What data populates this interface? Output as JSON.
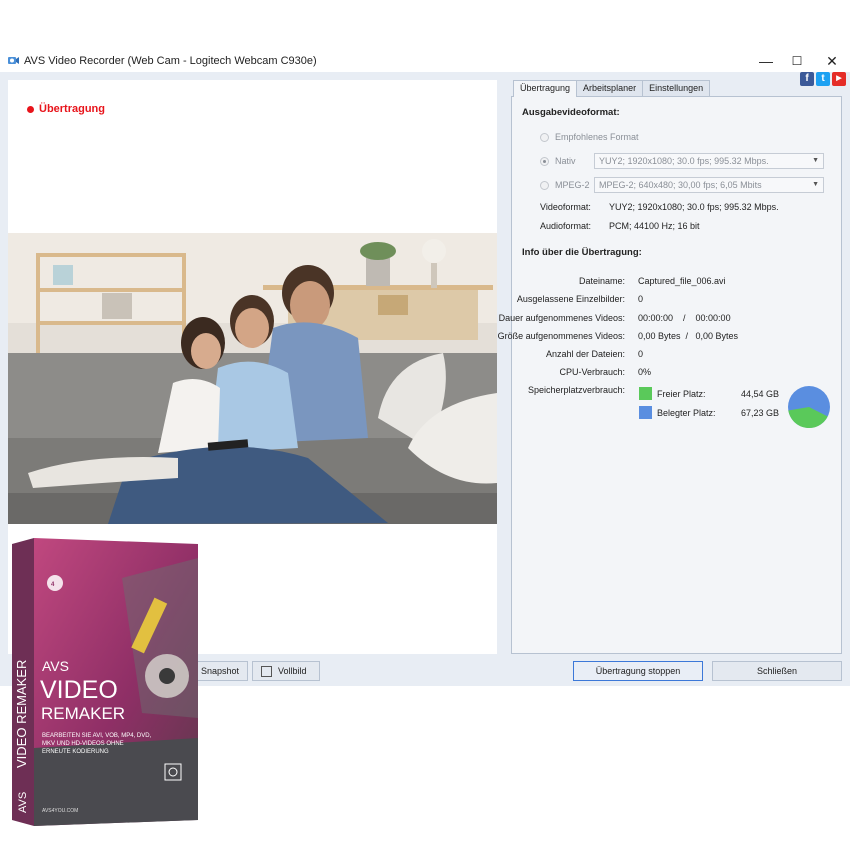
{
  "window": {
    "title": "AVS Video Recorder (Web Cam - Logitech Webcam C930e)",
    "minimize": "—",
    "maximize": "☐",
    "close": "✕"
  },
  "preview": {
    "status": "Übertragung"
  },
  "social": {
    "facebook": "f",
    "twitter": "t",
    "youtube": "▶"
  },
  "tabs": [
    "Übertragung",
    "Arbeitsplaner",
    "Einstellungen"
  ],
  "output": {
    "title": "Ausgabevideoformat:",
    "options": [
      {
        "label": "Empfohlenes Format",
        "checked": false
      },
      {
        "label": "Nativ",
        "checked": true,
        "value": "YUY2; 1920x1080; 30.0 fps; 995.32 Mbps."
      },
      {
        "label": "MPEG-2",
        "checked": false,
        "value": "MPEG-2; 640x480; 30,00 fps; 6,05 Mbits"
      }
    ],
    "video_label": "Videoformat:",
    "video_value": "YUY2; 1920x1080; 30.0 fps; 995.32 Mbps.",
    "audio_label": "Audioformat:",
    "audio_value": "PCM; 44100 Hz; 16 bit"
  },
  "info": {
    "title": "Info über die Übertragung:",
    "filename_label": "Dateiname:",
    "filename_value": "Captured_file_006.avi",
    "skipped_label": "Ausgelassene Einzelbilder:",
    "skipped_value": "0",
    "duration_label": "Dauer aufgenommenes Videos:",
    "duration_value": "00:00:00    /    00:00:00",
    "size_label": "Größe aufgenommenes Videos:",
    "size_value": "0,00 Bytes  /   0,00 Bytes",
    "files_label": "Anzahl der Dateien:",
    "files_value": "0",
    "cpu_label": "CPU-Verbrauch:",
    "cpu_value": "0%",
    "storage_label": "Speicherplatzverbrauch:",
    "free_label": "Freier Platz:",
    "free_value": "44,54 GB",
    "used_label": "Belegter Platz:",
    "used_value": "67,23 GB",
    "free_color": "#5ac95a",
    "used_color": "#5a8ee0",
    "free_gb": 44.54,
    "used_gb": 67.23
  },
  "buttons": {
    "snapshot": "Snapshot",
    "fullscreen": "Vollbild",
    "stop": "Übertragung stoppen",
    "close": "Schließen"
  },
  "product": {
    "brand": "AVS",
    "line1": "VIDEO",
    "line2": "REMAKER",
    "spine": "VIDEO REMAKER",
    "spine_brand": "AVS",
    "logo": "AVS4YOU",
    "description": "BEARBEITEN SIE AVI, VOB, MP4, DVD, MKV UND HD-VIDEOS OHNE ERNEUTE KODIERUNG",
    "url": "AVS4YOU.COM"
  }
}
